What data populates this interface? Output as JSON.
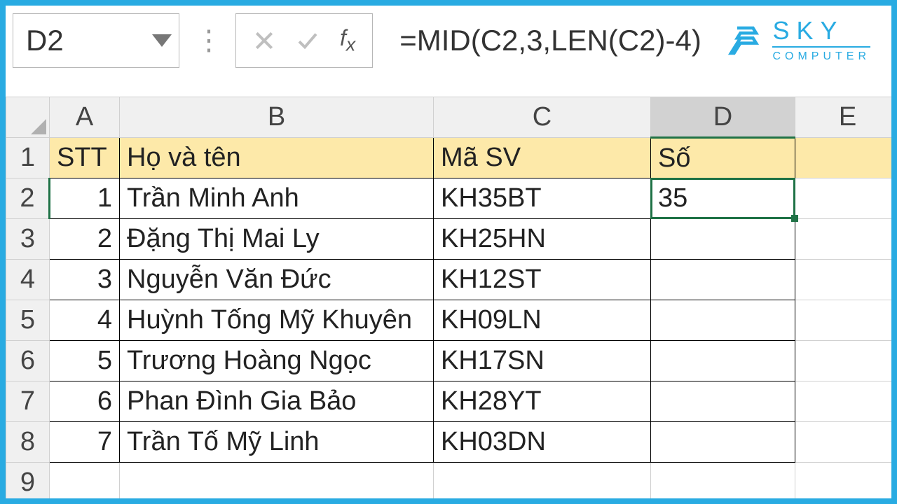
{
  "name_box": "D2",
  "formula": "=MID(C2,3,LEN(C2)-4)",
  "logo": {
    "top": "SKY",
    "bottom": "COMPUTER"
  },
  "columns": [
    "A",
    "B",
    "C",
    "D",
    "E"
  ],
  "row_numbers": [
    1,
    2,
    3,
    4,
    5,
    6,
    7,
    8,
    9
  ],
  "headers": {
    "A": "STT",
    "B": "Họ và tên",
    "C": "Mã SV",
    "D": "Số"
  },
  "selected_cell": "D2",
  "rows": [
    {
      "stt": 1,
      "name": "Trần Minh Anh",
      "code": "KH35BT",
      "num": "35"
    },
    {
      "stt": 2,
      "name": "Đặng Thị Mai Ly",
      "code": "KH25HN",
      "num": ""
    },
    {
      "stt": 3,
      "name": "Nguyễn Văn Đức",
      "code": "KH12ST",
      "num": ""
    },
    {
      "stt": 4,
      "name": "Huỳnh Tống Mỹ Khuyên",
      "code": "KH09LN",
      "num": ""
    },
    {
      "stt": 5,
      "name": "Trương Hoàng Ngọc",
      "code": "KH17SN",
      "num": ""
    },
    {
      "stt": 6,
      "name": "Phan Đình Gia Bảo",
      "code": "KH28YT",
      "num": ""
    },
    {
      "stt": 7,
      "name": "Trần Tố Mỹ Linh",
      "code": "KH03DN",
      "num": ""
    }
  ]
}
